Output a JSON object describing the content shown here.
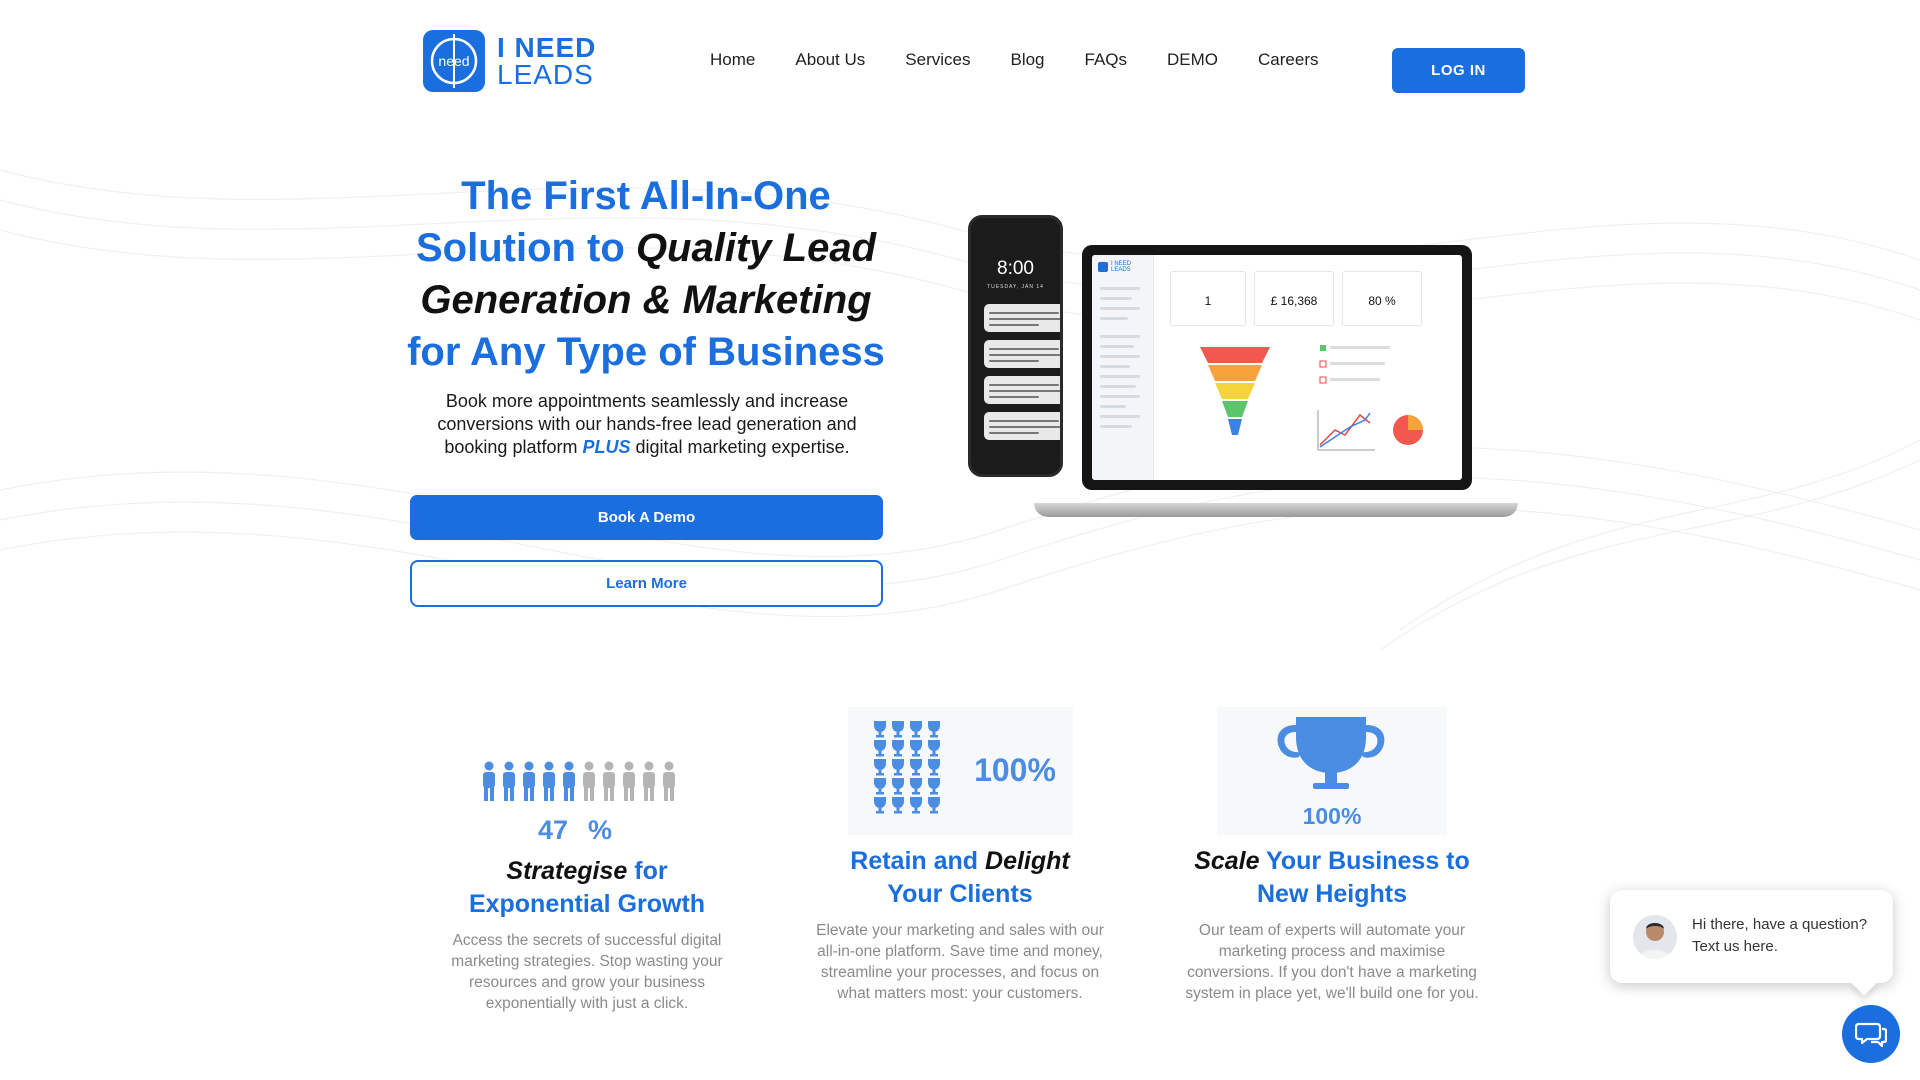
{
  "header": {
    "logo_line1": "I NEED",
    "logo_line2": "LEADS",
    "logo_mark_text": "need",
    "nav": [
      "Home",
      "About Us",
      "Services",
      "Blog",
      "FAQs",
      "DEMO",
      "Careers"
    ],
    "login_label": "LOG IN"
  },
  "hero": {
    "title_part1": "The First All-In-One Solution to ",
    "title_em": "Quality Lead Generation & Marketing",
    "title_part2": " for Any Type of Business",
    "subtitle_part1": "Book more appointments seamlessly and increase conversions with our hands-free lead generation and booking platform ",
    "subtitle_plus": "PLUS",
    "subtitle_part2": " digital marketing expertise.",
    "book_demo_label": "Book A Demo",
    "learn_more_label": "Learn More"
  },
  "mockup": {
    "phone_time": "8:00",
    "phone_date": "TUESDAY, JAN 14",
    "card_values": [
      "1",
      "£ 16,368",
      "80 %"
    ]
  },
  "features": [
    {
      "stat": "47",
      "stat_unit": "%",
      "title_em": "Strategise",
      "title_rest": " for Exponential Growth",
      "body": "Access the secrets of successful digital marketing strategies. Stop wasting your resources and grow your business exponentially with just a click."
    },
    {
      "stat": "100%",
      "title_rest1": "Retain and ",
      "title_em": "Delight",
      "title_rest2": " Your Clients",
      "body": "Elevate your marketing and sales with our all-in-one platform. Save time and money, streamline your processes, and focus on what matters most: your customers."
    },
    {
      "stat": "100%",
      "title_em": "Scale",
      "title_rest": " Your Business to New Heights",
      "body": "Our team of experts will automate your marketing process and maximise conversions. If you don't have a marketing system in place yet, we'll build one for you."
    }
  ],
  "chat": {
    "message": "Hi there, have a question? Text us here."
  },
  "colors": {
    "brand_blue": "#1a6ede",
    "icon_blue": "#4a8de3",
    "icon_grey": "#b5b5b5"
  }
}
